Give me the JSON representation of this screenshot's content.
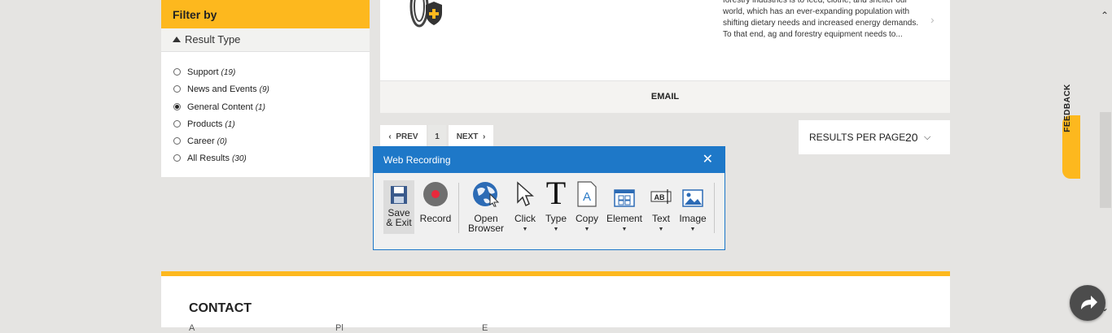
{
  "filter": {
    "header": "Filter by",
    "section_title": "Result Type",
    "options": [
      {
        "label": "Support",
        "count": "(19)",
        "checked": false
      },
      {
        "label": "News and Events",
        "count": "(9)",
        "checked": false
      },
      {
        "label": "General Content",
        "count": "(1)",
        "checked": true
      },
      {
        "label": "Products",
        "count": "(1)",
        "checked": false
      },
      {
        "label": "Career",
        "count": "(0)",
        "checked": false
      },
      {
        "label": "All Results",
        "count": "(30)",
        "checked": false
      }
    ]
  },
  "result": {
    "snippet": "forestry industries is to feed, clothe, and shelter our world, which has an ever-expanding population with shifting dietary needs and increased energy demands. To that end, ag and forestry equipment needs to...",
    "email_label": "EMAIL"
  },
  "pagination": {
    "prev": "PREV",
    "current_page": "1",
    "next": "NEXT",
    "results_per_page_label": "RESULTS PER PAGE",
    "results_per_page_value": "20"
  },
  "recorder": {
    "title": "Web Recording",
    "tools": {
      "save": "Save & Exit",
      "record": "Record",
      "open_browser": "Open Browser",
      "click": "Click",
      "type": "Type",
      "copy": "Copy",
      "element": "Element",
      "text": "Text",
      "image": "Image"
    }
  },
  "contact": {
    "title": "CONTACT",
    "cut_a": "A",
    "cut_b": "Pl",
    "cut_c": "E"
  },
  "feedback_label": "FEEDBACK",
  "colors": {
    "accent": "#fdb81e",
    "dialog_blue": "#1e78c8",
    "page_bg": "#e5e4e2"
  }
}
